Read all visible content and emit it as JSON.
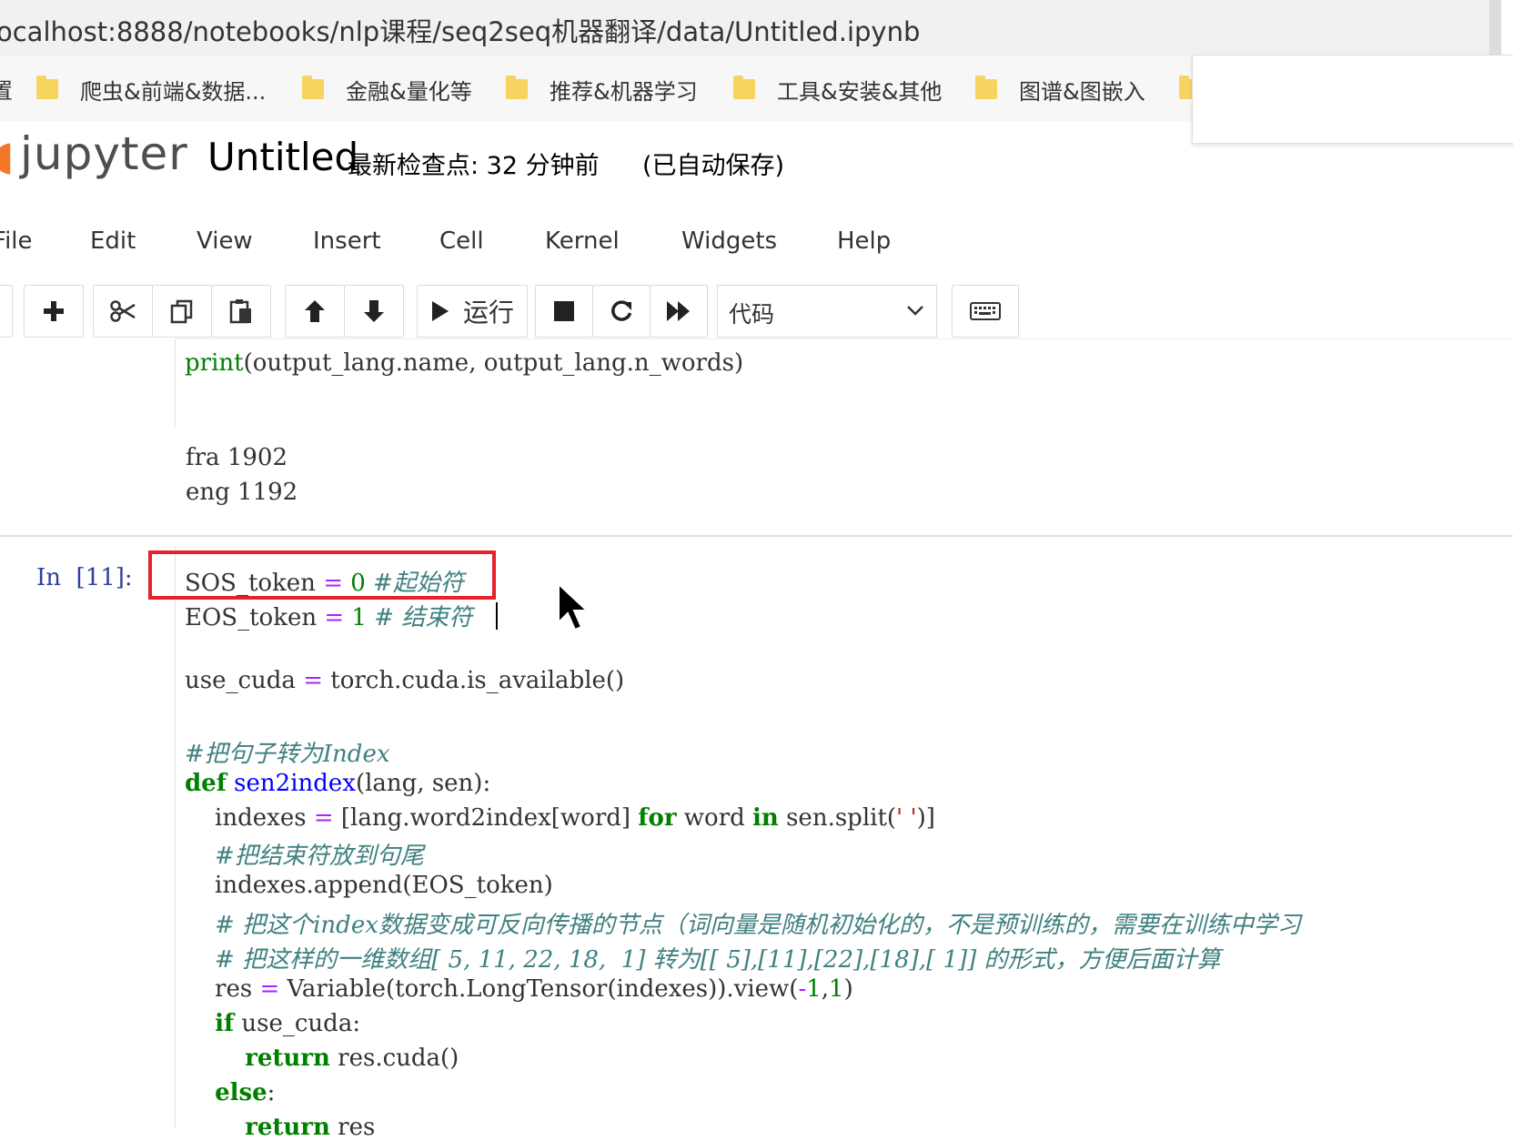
{
  "browser": {
    "url": "ocalhost:8888/notebooks/nlp课程/seq2seq机器翻译/data/Untitled.ipynb",
    "bookmarks": [
      "爬虫&前端&数据...",
      "金融&量化等",
      "推荐&机器学习",
      "工具&安装&其他",
      "图谱&图嵌入"
    ],
    "bookmark_edge": "置"
  },
  "jupyter": {
    "logo": "jupyter",
    "notebook_title": "Untitled",
    "checkpoint": "最新检查点: 32 分钟前",
    "autosave": "(已自动保存)"
  },
  "menu": [
    "File",
    "Edit",
    "View",
    "Insert",
    "Cell",
    "Kernel",
    "Widgets",
    "Help"
  ],
  "toolbar": {
    "run_label": "运行",
    "cell_type": "代码"
  },
  "cell_prev": {
    "code": "print(output_lang.name, output_lang.n_words)",
    "output": [
      "fra 1902",
      "eng 1192"
    ]
  },
  "cell_current": {
    "prompt": "In  [11]:",
    "lines": {
      "sos": "SOS_token = 0 #起始符",
      "eos": "EOS_token = 1 # 结束符",
      "use_cuda": "use_cuda = torch.cuda.is_available()",
      "c1": "#把句子转为Index",
      "def": "def sen2index(lang, sen):",
      "indexes": "    indexes = [lang.word2index[word] for word in sen.split(' ')]",
      "c2": "    #把结束符放到句尾",
      "append": "    indexes.append(EOS_token)",
      "c3": "    # 把这个index数据变成可反向传播的节点（词向量是随机初始化的，不是预训练的，需要在训练中学习",
      "c4": "    # 把这样的一维数组[ 5, 11, 22, 18,  1] 转为[[ 5],[11],[22],[18],[ 1]] 的形式，方便后面计算",
      "res": "    res = Variable(torch.LongTensor(indexes)).view(-1,1)",
      "if": "    if use_cuda:",
      "ret1": "        return res.cuda()",
      "else": "    else:",
      "ret2": "        return res"
    }
  },
  "colors": {
    "highlight": "#e8202a",
    "keyword": "#008000",
    "comment": "#408080",
    "function": "#0000ff",
    "prompt": "#303f9f"
  }
}
